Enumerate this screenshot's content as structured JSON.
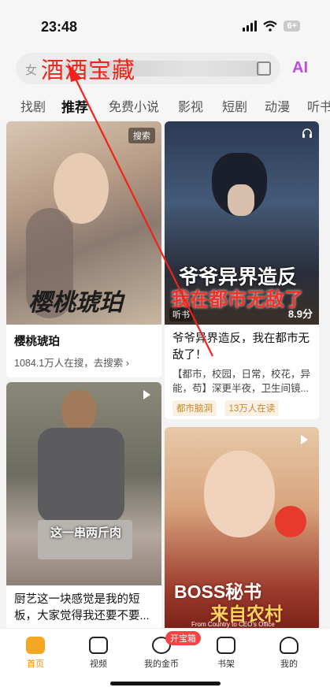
{
  "status_bar": {
    "time": "23:48",
    "battery": "6+"
  },
  "search": {
    "prefix": "女",
    "overlay_text": "酒酒宝藏",
    "ai_label": "AI"
  },
  "tabs": [
    "找剧",
    "推荐",
    "免费小说",
    "影视",
    "短剧",
    "动漫",
    "听书"
  ],
  "active_tab": 1,
  "cards": {
    "c1": {
      "badge": "搜索",
      "image_text": "樱桃琥珀",
      "title": "樱桃琥珀",
      "subtitle": "1084.1万人在搜，去搜索 ›"
    },
    "c2": {
      "image_title_1": "爷爷异界造反",
      "image_title_2": "我在都市无敌了",
      "image_tag": "听书",
      "rating": "8.9分",
      "title": "爷爷异界造反，我在都市无敌了！",
      "desc": "【都市，校园，日常，校花，异能，苟】深更半夜，卫生间镜...",
      "tags": [
        "都市脑洞",
        "13万人在读"
      ]
    },
    "c3": {
      "image_caption": "这一串两斤肉",
      "title": "厨艺这一块感觉是我的短板，大家觉得我还要不要..."
    },
    "c4": {
      "image_title_1": "BOSS秘书",
      "image_title_2": "来自农村",
      "image_caption": "From Country to CEO's Office"
    }
  },
  "bottom_nav": [
    {
      "label": "首页",
      "icon": "home-icon"
    },
    {
      "label": "视频",
      "icon": "video-icon"
    },
    {
      "label": "我的金币",
      "icon": "coin-icon"
    },
    {
      "label": "书架",
      "icon": "bookshelf-icon"
    },
    {
      "label": "我的",
      "icon": "profile-icon"
    }
  ],
  "coin_badge": "开宝箱",
  "colors": {
    "accent": "#f08a00",
    "annotation": "#f0221a",
    "badge": "#f24646"
  }
}
